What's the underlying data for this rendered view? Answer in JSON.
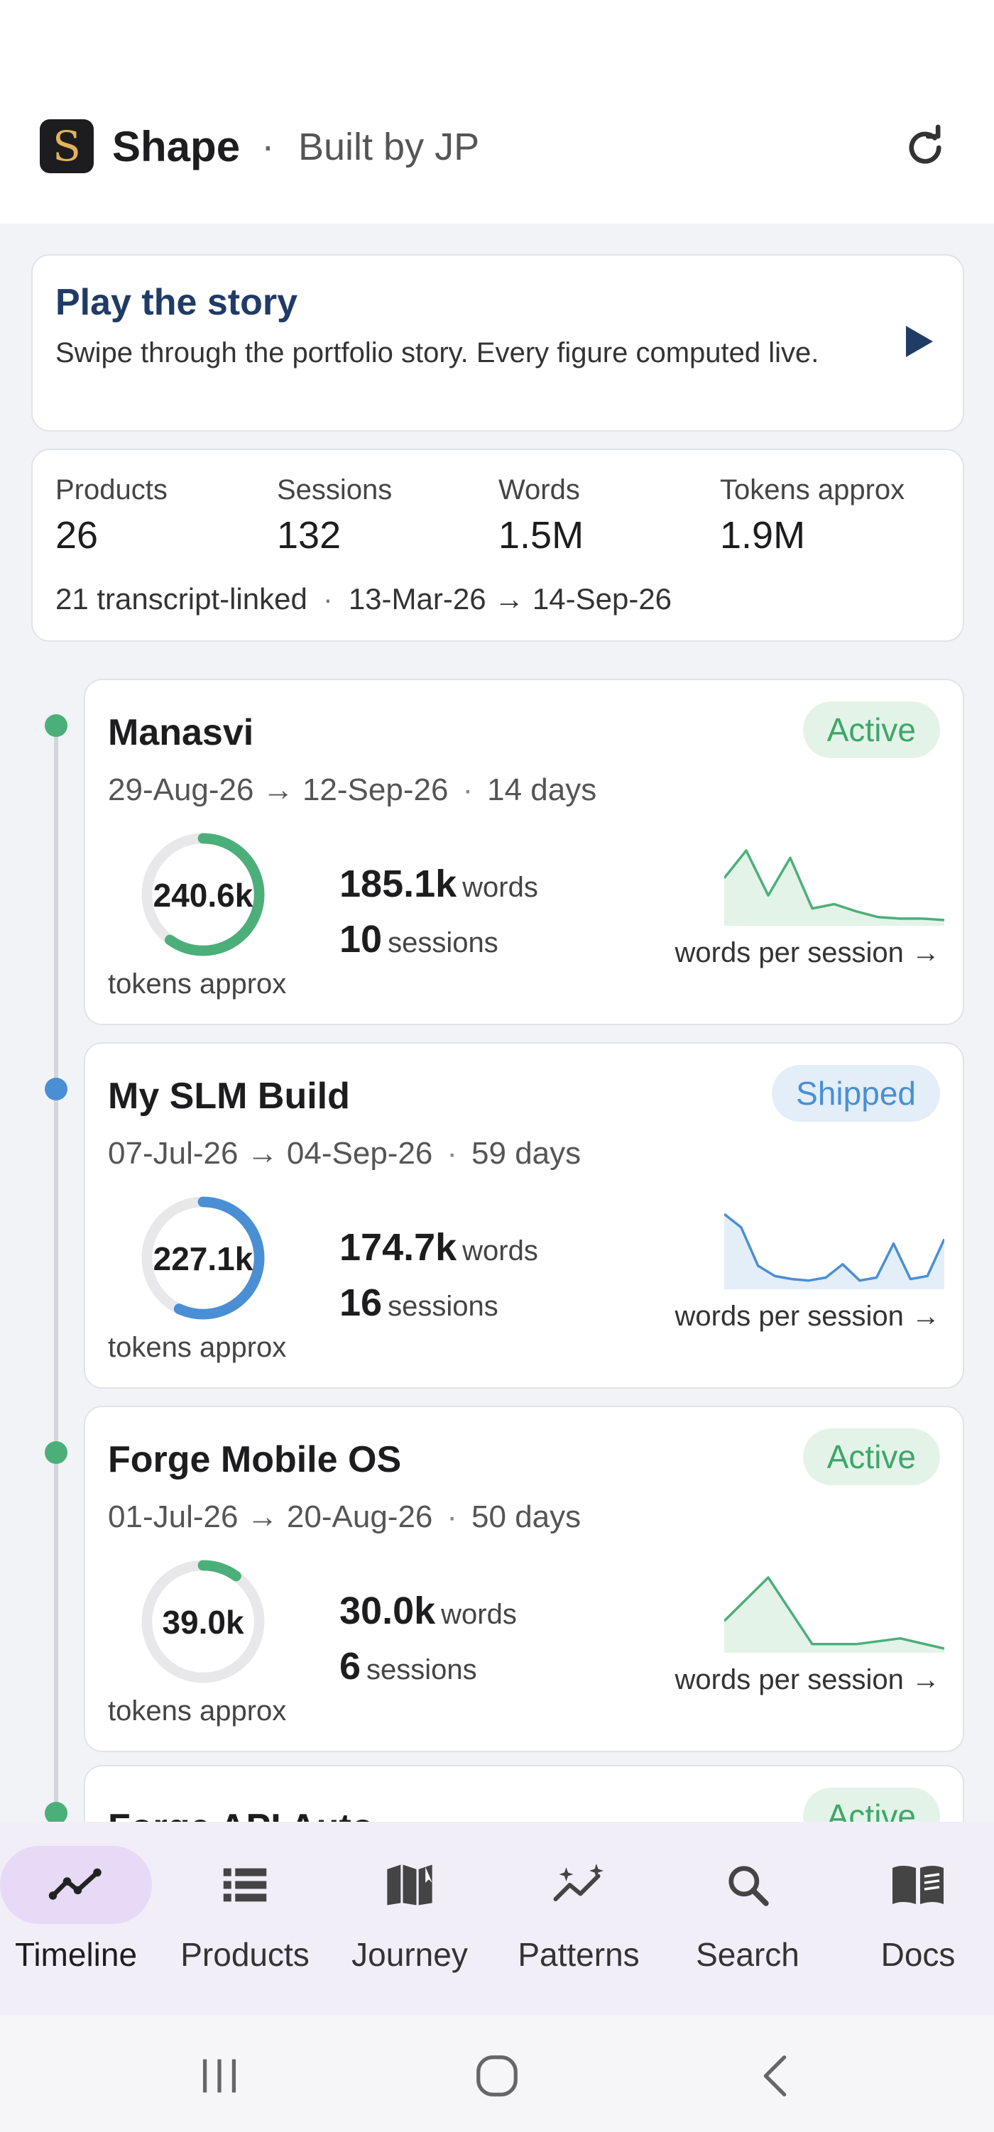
{
  "app": {
    "logo_letter": "S",
    "name": "Shape",
    "separator": "·",
    "subtitle": "Built by JP",
    "refresh_icon": "refresh-icon"
  },
  "story": {
    "title": "Play the story",
    "description": "Swipe through the portfolio story. Every figure computed live.",
    "play_icon": "play-icon"
  },
  "stats": {
    "products_label": "Products",
    "products_value": "26",
    "sessions_label": "Sessions",
    "sessions_value": "132",
    "words_label": "Words",
    "words_value": "1.5M",
    "tokens_label": "Tokens approx",
    "tokens_value": "1.9M",
    "transcript_linked": "21 transcript-linked",
    "separator": "·",
    "date_range": "13-Mar-26 → 14-Sep-26"
  },
  "projects": [
    {
      "name": "Manasvi",
      "status": "Active",
      "status_color": "#3fa66a",
      "status_bg": "#e3f3e8",
      "dot_color": "#4caf7a",
      "start": "29-Aug-26",
      "arrow": "→",
      "end": "12-Sep-26",
      "separator": "·",
      "duration": "14 days",
      "tokens": "240.6k",
      "tokens_label": "tokens approx",
      "ring_fraction": 0.6,
      "ring_color": "#4caf7a",
      "words": "185.1k",
      "words_unit": "words",
      "sessions": "10",
      "sessions_unit": "sessions",
      "spark_label": "words per session →",
      "spark_color": "#4caf7a",
      "spark_fill": "#e3f3e8",
      "spark_values": [
        62,
        100,
        38,
        90,
        20,
        26,
        16,
        8,
        6,
        6,
        4
      ]
    },
    {
      "name": "My SLM Build",
      "status": "Shipped",
      "status_color": "#4a8fd4",
      "status_bg": "#e3eef8",
      "dot_color": "#4a8fd4",
      "start": "07-Jul-26",
      "arrow": "→",
      "end": "04-Sep-26",
      "separator": "·",
      "duration": "59 days",
      "tokens": "227.1k",
      "tokens_label": "tokens approx",
      "ring_fraction": 0.57,
      "ring_color": "#4a8fd4",
      "words": "174.7k",
      "words_unit": "words",
      "sessions": "16",
      "sessions_unit": "sessions",
      "spark_label": "words per session →",
      "spark_color": "#4a8fd4",
      "spark_fill": "#e3eef8",
      "spark_values": [
        98,
        80,
        28,
        14,
        10,
        8,
        12,
        30,
        8,
        12,
        58,
        10,
        14,
        64
      ]
    },
    {
      "name": "Forge Mobile OS",
      "status": "Active",
      "status_color": "#3fa66a",
      "status_bg": "#e3f3e8",
      "dot_color": "#4caf7a",
      "start": "01-Jul-26",
      "arrow": "→",
      "end": "20-Aug-26",
      "separator": "·",
      "duration": "50 days",
      "tokens": "39.0k",
      "tokens_label": "tokens approx",
      "ring_fraction": 0.1,
      "ring_color": "#4caf7a",
      "words": "30.0k",
      "words_unit": "words",
      "sessions": "6",
      "sessions_unit": "sessions",
      "spark_label": "words per session →",
      "spark_color": "#4caf7a",
      "spark_fill": "#e3f3e8",
      "spark_values": [
        40,
        100,
        8,
        8,
        16,
        2
      ]
    }
  ],
  "peek_project": {
    "name": "Forge API Auto",
    "status": "Active",
    "dot_color": "#4caf7a"
  },
  "nav": {
    "items": [
      {
        "label": "Timeline",
        "icon": "trend-line-icon",
        "active": true
      },
      {
        "label": "Products",
        "icon": "list-icon",
        "active": false
      },
      {
        "label": "Journey",
        "icon": "map-icon",
        "active": false
      },
      {
        "label": "Patterns",
        "icon": "sparkle-trend-icon",
        "active": false
      },
      {
        "label": "Search",
        "icon": "search-icon",
        "active": false
      },
      {
        "label": "Docs",
        "icon": "book-icon",
        "active": false
      }
    ]
  },
  "system_nav": {
    "recents_icon": "recents-icon",
    "home_icon": "home-icon",
    "back_icon": "back-icon"
  }
}
